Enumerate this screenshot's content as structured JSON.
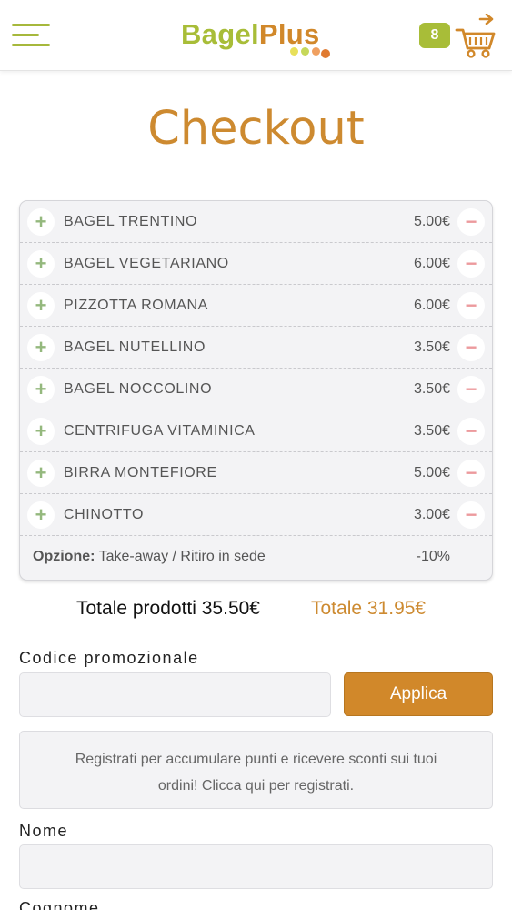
{
  "header": {
    "logo_part1": "Bagel",
    "logo_part2": "Plus",
    "cart_count": "8",
    "icons": {
      "menu": "hamburger-icon",
      "cart": "cart-icon"
    }
  },
  "page_title": "Checkout",
  "cart": {
    "items": [
      {
        "name": "BAGEL TRENTINO",
        "price": "5.00€"
      },
      {
        "name": "BAGEL VEGETARIANO",
        "price": "6.00€"
      },
      {
        "name": "PIZZOTTA ROMANA",
        "price": "6.00€"
      },
      {
        "name": "BAGEL NUTELLINO",
        "price": "3.50€"
      },
      {
        "name": "BAGEL NOCCOLINO",
        "price": "3.50€"
      },
      {
        "name": "CENTRIFUGA VITAMINICA",
        "price": "3.50€"
      },
      {
        "name": "BIRRA MONTEFIORE",
        "price": "5.00€"
      },
      {
        "name": "CHINOTTO",
        "price": "3.00€"
      }
    ],
    "plus_symbol": "+",
    "minus_symbol": "−",
    "option_label": "Opzione:",
    "option_value": " Take-away / Ritiro in sede",
    "option_discount": "-10%"
  },
  "totals": {
    "products": "Totale prodotti 35.50€",
    "final": "Totale 31.95€"
  },
  "promo": {
    "label": "Codice promozionale",
    "value": "",
    "apply_label": "Applica"
  },
  "register_text": "Registrati per accumulare punti e ricevere sconti sui tuoi ordini! Clicca qui per registrati.",
  "form": {
    "name_label": "Nome",
    "name_value": "",
    "surname_label": "Cognome"
  },
  "colors": {
    "brand_green": "#a8bd38",
    "brand_orange": "#d1882a",
    "plus_green": "#94b87d",
    "minus_red": "#ec9a9d"
  }
}
